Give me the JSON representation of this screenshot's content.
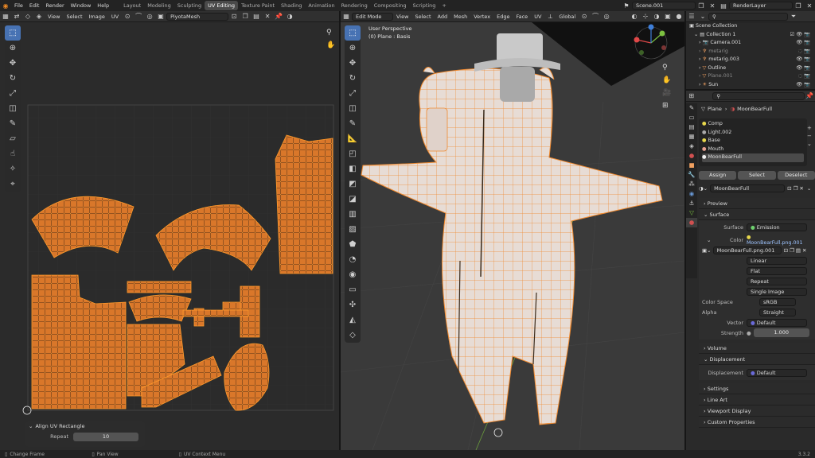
{
  "menus": [
    "File",
    "Edit",
    "Render",
    "Window",
    "Help"
  ],
  "workspace_tabs": [
    "Layout",
    "Modeling",
    "Sculpting",
    "UV Editing",
    "Texture Paint",
    "Shading",
    "Animation",
    "Rendering",
    "Compositing",
    "Scripting"
  ],
  "active_tab": "UV Editing",
  "scene_name": "Scene.001",
  "view_layer": "RenderLayer",
  "uv_editor": {
    "menus": [
      "View",
      "Select",
      "Image",
      "UV"
    ],
    "mesh_name": "PiyotaMesh",
    "operator_panel": {
      "title": "Align UV Rectangle",
      "repeat_label": "Repeat",
      "repeat_value": "10"
    }
  },
  "viewport": {
    "mode": "Edit Mode",
    "menus": [
      "View",
      "Select",
      "Add",
      "Mesh",
      "Vertex",
      "Edge",
      "Face",
      "UV"
    ],
    "transform": "Global",
    "overlay_title": "User Perspective",
    "overlay_sub": "(0) Plane : Basis"
  },
  "outliner": {
    "root": "Scene Collection",
    "collection": "Collection 1",
    "items": [
      "Camera.001",
      "metarig",
      "metarig.003",
      "Outline",
      "Plane.001",
      "Sun"
    ]
  },
  "properties": {
    "breadcrumb_object": "Plane",
    "breadcrumb_material": "MoonBearFull",
    "materials": [
      {
        "name": "Comp",
        "color": "#e8d84c"
      },
      {
        "name": "Light.002",
        "color": "#aaaaaa"
      },
      {
        "name": "Base",
        "color": "#e8d84c"
      },
      {
        "name": "Mouth",
        "color": "#e8a090"
      },
      {
        "name": "MoonBearFull",
        "color": "#f0f0f0"
      }
    ],
    "assign": "Assign",
    "select": "Select",
    "deselect": "Deselect",
    "material_field": "MoonBearFull",
    "preview": "Preview",
    "surface": "Surface",
    "surface_label": "Surface",
    "surface_value": "Emission",
    "color_label": "Color",
    "color_value": "MoonBearFull.png.001",
    "image_field": "MoonBearFull.png.001",
    "interp": "Linear",
    "projection": "Flat",
    "extension": "Repeat",
    "source": "Single Image",
    "color_space_label": "Color Space",
    "color_space": "sRGB",
    "alpha_label": "Alpha",
    "alpha": "Straight",
    "vector_label": "Vector",
    "vector": "Default",
    "strength_label": "Strength",
    "strength": "1.000",
    "volume": "Volume",
    "displacement": "Displacement",
    "disp_label": "Displacement",
    "disp_value": "Default",
    "settings": "Settings",
    "lineart": "Line Art",
    "viewport_display": "Viewport Display",
    "custom_props": "Custom Properties"
  },
  "status": {
    "left": "Change Frame",
    "mid": "Pan View",
    "right": "UV Context Menu",
    "version": "3.3.2"
  },
  "colors": {
    "accent": "#4772b3",
    "uv_fill": "#d9772a",
    "edge": "#ff8a1f"
  }
}
